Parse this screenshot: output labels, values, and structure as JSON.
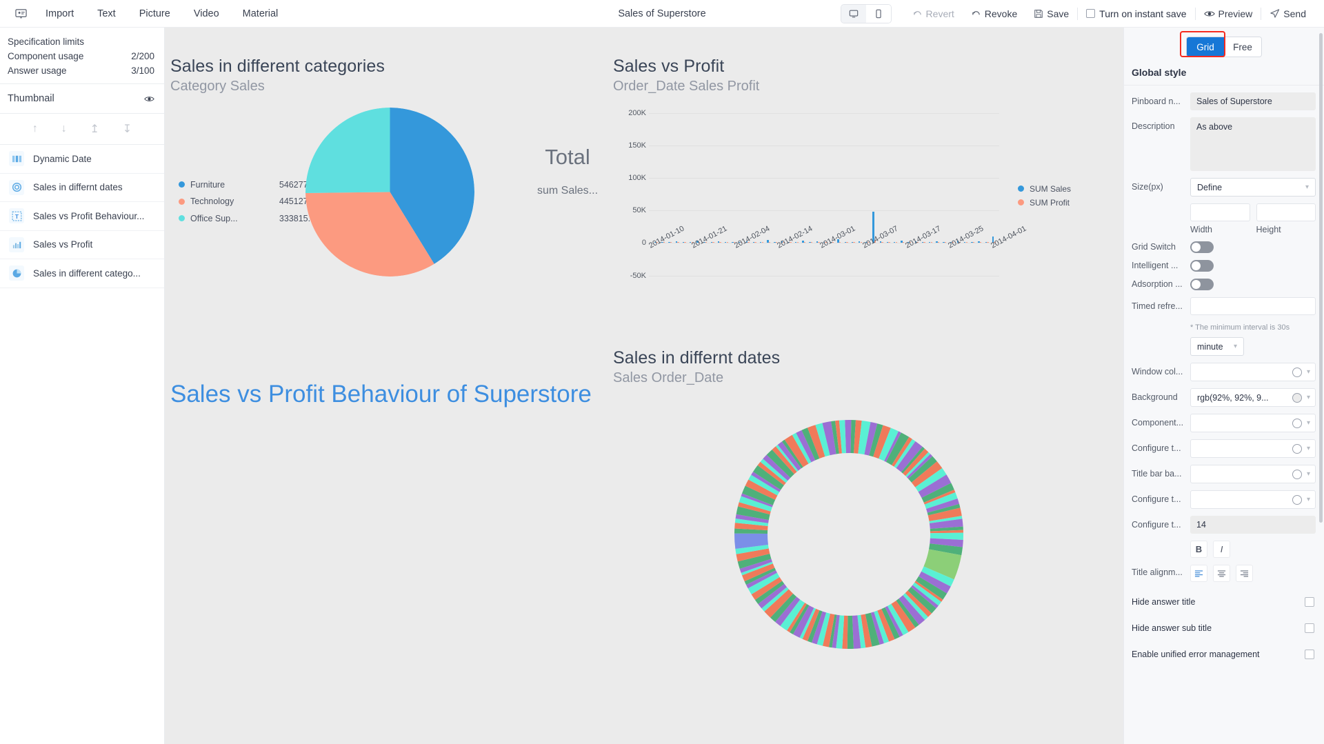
{
  "topbar": {
    "logo_icon": "presentation-icon",
    "menu": [
      {
        "label": "Import"
      },
      {
        "label": "Text"
      },
      {
        "label": "Picture"
      },
      {
        "label": "Video"
      },
      {
        "label": "Material"
      }
    ],
    "title": "Sales of Superstore",
    "device_desktop_icon": "monitor-icon",
    "device_mobile_icon": "phone-icon",
    "revert_label": "Revert",
    "revert_icon": "undo-arrow-icon",
    "revoke_label": "Revoke",
    "revoke_icon": "redo-arrow-icon",
    "save_label": "Save",
    "save_icon": "floppy-disk-icon",
    "instant_save_label": "Turn on instant save",
    "preview_label": "Preview",
    "preview_icon": "eye-icon",
    "send_label": "Send",
    "send_icon": "paper-plane-icon"
  },
  "left_panel": {
    "spec_limits_label": "Specification limits",
    "component_usage_label": "Component usage",
    "component_usage_value": "2/200",
    "answer_usage_label": "Answer usage",
    "answer_usage_value": "3/100",
    "thumbnail_label": "Thumbnail",
    "thumbnail_icon": "eye-icon",
    "tools": [
      {
        "name": "move-up-icon",
        "glyph": "↑"
      },
      {
        "name": "move-down-icon",
        "glyph": "↓"
      },
      {
        "name": "move-to-top-icon",
        "glyph": "↥"
      },
      {
        "name": "move-to-bottom-icon",
        "glyph": "↧"
      }
    ],
    "items": [
      {
        "label": "Dynamic Date",
        "icon": "date-component-icon"
      },
      {
        "label": "Sales in differnt dates",
        "icon": "donut-chart-icon"
      },
      {
        "label": "Sales vs Profit Behaviour...",
        "icon": "text-component-icon"
      },
      {
        "label": "Sales vs Profit",
        "icon": "bar-chart-icon"
      },
      {
        "label": "Sales in different catego...",
        "icon": "pie-chart-icon"
      }
    ]
  },
  "canvas": {
    "background": "#ebebeb",
    "pie_widget": {
      "title": "Sales in different categories",
      "subtitle": "Category Sales",
      "total_label": "Total",
      "total_sub": "sum Sales...",
      "chart_data": {
        "type": "pie",
        "title": "Sales in different categories",
        "categories": [
          "Furniture",
          "Technology",
          "Office Sup..."
        ],
        "values": [
          546277.54,
          445127.71,
          333815.7
        ],
        "value_labels": [
          "546277.54",
          "445127.71",
          "333815.70"
        ],
        "colors": [
          "#3498db",
          "#fc9a80",
          "#5fdfdf"
        ],
        "legend": "left"
      }
    },
    "svp_widget": {
      "title": "Sales vs Profit",
      "subtitle": "Order_Date Sales Profit",
      "chart_data": {
        "type": "bar",
        "title": "Sales vs Profit",
        "xlabel": "Order_Date",
        "ylabel": "",
        "ylim": [
          -50000,
          200000
        ],
        "yticks": [
          200000,
          150000,
          100000,
          50000,
          0,
          -50000
        ],
        "ytick_labels": [
          "200K",
          "150K",
          "100K",
          "50K",
          "0",
          "-50K"
        ],
        "xtick_labels": [
          "2014-01-10",
          "2014-01-21",
          "2014-02-04",
          "2014-02-14",
          "2014-03-01",
          "2014-03-07",
          "2014-03-17",
          "2014-03-25",
          "2014-04-01"
        ],
        "legend": [
          "SUM Sales",
          "SUM Profit"
        ],
        "legend_colors": [
          "#3498db",
          "#fc9a80"
        ],
        "grid": true,
        "series": [
          {
            "name": "SUM Sales",
            "color": "#3498db",
            "values": [
              1200,
              300,
              900,
              2100,
              600,
              1500,
              3300,
              700,
              1100,
              2600,
              500,
              1800,
              900,
              2400,
              1300,
              700,
              4200,
              1000,
              2900,
              1600,
              600,
              3100,
              800,
              2200,
              1400,
              900,
              5200,
              1700,
              600,
              2800,
              1200,
              48000,
              2300,
              900,
              1500,
              3700,
              800,
              2000,
              1100,
              600,
              2600,
              1400,
              900,
              3000,
              1800,
              700,
              2400,
              1300,
              9500
            ]
          },
          {
            "name": "SUM Profit",
            "color": "#fc9a80",
            "values": [
              200,
              60,
              150,
              350,
              110,
              260,
              520,
              120,
              190,
              430,
              90,
              310,
              150,
              400,
              220,
              120,
              690,
              170,
              480,
              270,
              100,
              510,
              140,
              370,
              240,
              150,
              860,
              290,
              100,
              470,
              200,
              3200,
              390,
              150,
              260,
              610,
              140,
              330,
              190,
              100,
              440,
              240,
              150,
              500,
              300,
              120,
              400,
              220,
              1500
            ]
          }
        ]
      }
    },
    "text_widget": {
      "text": "Sales vs Profit Behaviour of Superstore",
      "color": "#3d8ee0"
    },
    "donut_widget": {
      "title": "Sales in differnt dates",
      "subtitle": "Sales Order_Date",
      "chart_data": {
        "type": "pie",
        "variant": "donut",
        "title": "Sales in differnt dates",
        "categories": [
          "Order_Date"
        ],
        "note": "many small multi-colored date slices",
        "segment_count": 120
      }
    }
  },
  "right_panel": {
    "mode_grid": "Grid",
    "mode_free": "Free",
    "active_mode": "Grid",
    "highlight_color": "#f52a1e",
    "accent_color": "#1677d6",
    "heading": "Global style",
    "pinboard_label": "Pinboard n...",
    "pinboard_value": "Sales of Superstore",
    "description_label": "Description",
    "description_value": "As above",
    "size_label": "Size(px)",
    "size_value": "Define",
    "width_label": "Width",
    "width_value": "",
    "height_label": "Height",
    "height_value": "",
    "grid_switch_label": "Grid Switch",
    "intelligent_label": "Intelligent ...",
    "adsorption_label": "Adsorption ...",
    "timed_refresh_label": "Timed refre...",
    "timed_refresh_value": "",
    "interval_hint": "* The minimum interval is 30s",
    "interval_unit": "minute",
    "window_color_label": "Window col...",
    "window_color_value": "",
    "background_label": "Background",
    "background_value": "rgb(92%, 92%, 9...",
    "component_label": "Component...",
    "component_value": "",
    "configure1_label": "Configure t...",
    "configure1_value": "",
    "titlebar_label": "Title bar ba...",
    "titlebar_value": "",
    "configure2_label": "Configure t...",
    "configure2_value": "",
    "configure3_label": "Configure t...",
    "configure3_value": "14",
    "bold_label": "B",
    "italic_label": "I",
    "title_align_label": "Title alignm...",
    "align_left_icon": "align-left-icon",
    "align_center_icon": "align-center-icon",
    "align_right_icon": "align-right-icon",
    "hide_answer_title": "Hide answer title",
    "hide_answer_sub_title": "Hide answer sub title",
    "enable_unified_error": "Enable unified error management"
  }
}
